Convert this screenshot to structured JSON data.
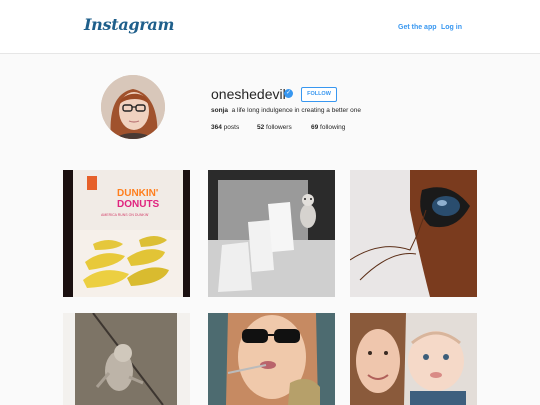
{
  "header": {
    "logo_text": "Instagram",
    "get_app_label": "Get the app",
    "login_label": "Log in"
  },
  "profile": {
    "username": "oneshedevil",
    "verified_icon": "checkmark",
    "follow_label": "FOLLOW",
    "bio_name": "sonja",
    "bio_text": "a life long indulgence in creating a better one",
    "posts_count": "364",
    "posts_label": "posts",
    "followers_count": "52",
    "followers_label": "followers",
    "following_count": "69",
    "following_label": "following"
  },
  "grid": {
    "tile1": {
      "brand_line1": "DUNKIN'",
      "brand_line2": "DONUTS",
      "tagline": "AMERICA RUNS ON DUNKIN'"
    }
  },
  "colors": {
    "accent": "#3897f0",
    "logo": "#1f5f8b"
  }
}
